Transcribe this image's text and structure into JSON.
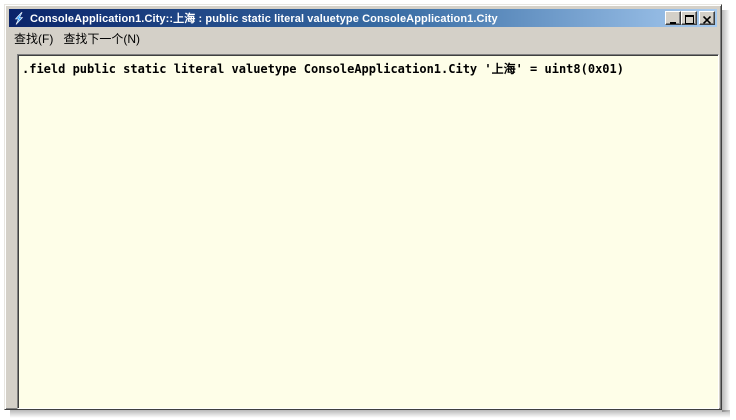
{
  "window": {
    "title": "ConsoleApplication1.City::上海 : public static literal valuetype ConsoleApplication1.City"
  },
  "menu": {
    "items": [
      {
        "label": "查找(F)"
      },
      {
        "label": "查找下一个(N)"
      }
    ]
  },
  "content": {
    "line": ".field public static literal valuetype ConsoleApplication1.City '上海' = uint8(0x01)"
  },
  "colors": {
    "title_start": "#0a246a",
    "title_end": "#a6caf0",
    "content_background": "#fefee8",
    "chrome": "#d4d0c8"
  },
  "icons": {
    "app": "lightning-icon",
    "minimize": "minimize-icon",
    "maximize": "maximize-icon",
    "close": "close-icon"
  }
}
